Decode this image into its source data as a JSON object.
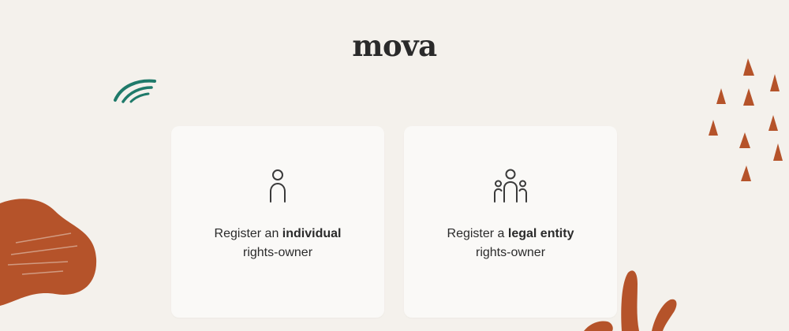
{
  "brand": {
    "logo_text": "mova"
  },
  "colors": {
    "background": "#f4f1ec",
    "card": "#faf9f7",
    "accent_rust": "#b5532a",
    "accent_teal": "#1f7a6a",
    "text": "#2b2b2b"
  },
  "cards": [
    {
      "icon": "person-icon",
      "prefix": "Register an ",
      "emphasis": "individual",
      "suffix": "rights-owner"
    },
    {
      "icon": "group-icon",
      "prefix": "Register a ",
      "emphasis": "legal entity",
      "suffix": "rights-owner"
    }
  ]
}
